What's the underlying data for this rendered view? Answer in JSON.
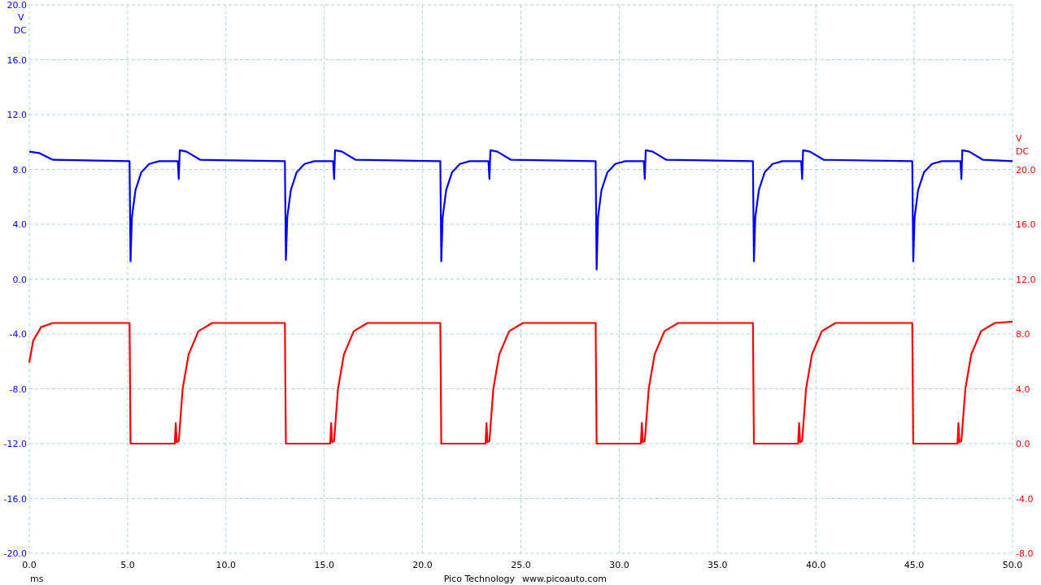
{
  "scope": {
    "chart_data": {
      "type": "line",
      "grid": true,
      "xlabel": "ms",
      "xlim": [
        0,
        50
      ],
      "xticks": [
        {
          "value": 0,
          "label": "0.0"
        },
        {
          "value": 5,
          "label": "5.0"
        },
        {
          "value": 10,
          "label": "10.0"
        },
        {
          "value": 15,
          "label": "15.0"
        },
        {
          "value": 20,
          "label": "20.0"
        },
        {
          "value": 25,
          "label": "25.0"
        },
        {
          "value": 30,
          "label": "30.0"
        },
        {
          "value": 35,
          "label": "35.0"
        },
        {
          "value": 40,
          "label": "40.0"
        },
        {
          "value": 45,
          "label": "45.0"
        },
        {
          "value": 50,
          "label": "50.0"
        }
      ],
      "ylim": [
        -20,
        20
      ],
      "yticks": [
        {
          "value": 20,
          "label": "20.0"
        },
        {
          "value": 16,
          "label": "16.0"
        },
        {
          "value": 12,
          "label": "12.0"
        },
        {
          "value": 8,
          "label": "8.0"
        },
        {
          "value": 4,
          "label": "4.0"
        },
        {
          "value": 0,
          "label": "0.0"
        },
        {
          "value": -4,
          "label": "-4.0"
        },
        {
          "value": -8,
          "label": "-8.0"
        },
        {
          "value": -12,
          "label": "-12.0"
        },
        {
          "value": -16,
          "label": "-16.0"
        },
        {
          "value": -20,
          "label": "-20.0"
        }
      ],
      "ylabel": "V DC",
      "y2lim": [
        -8,
        32
      ],
      "y2ticks": [
        {
          "value": 20,
          "label": "20.0"
        },
        {
          "value": 16,
          "label": "16.0"
        },
        {
          "value": 12,
          "label": "12.0"
        },
        {
          "value": 8,
          "label": "8.0"
        },
        {
          "value": 4,
          "label": "4.0"
        },
        {
          "value": 0,
          "label": "0.0"
        },
        {
          "value": -4,
          "label": "-4.0"
        },
        {
          "value": -8,
          "label": "-8.0"
        }
      ],
      "y2label": "V DC",
      "series": [
        {
          "color": "#0000ff",
          "x": [
            0,
            0.5,
            1.2,
            5.1,
            5.15,
            5.22,
            5.4,
            5.7,
            6.1,
            6.6,
            7.55,
            7.6,
            7.65,
            8.0,
            8.7,
            13.0,
            13.05,
            13.12,
            13.3,
            13.6,
            14.0,
            14.5,
            15.45,
            15.5,
            15.55,
            15.9,
            16.6,
            20.9,
            20.95,
            21.02,
            21.2,
            21.5,
            21.9,
            22.4,
            23.35,
            23.4,
            23.45,
            23.8,
            24.5,
            28.8,
            28.85,
            28.92,
            29.1,
            29.4,
            29.8,
            30.3,
            31.25,
            31.3,
            31.35,
            31.7,
            32.4,
            36.8,
            36.85,
            36.92,
            37.1,
            37.4,
            37.8,
            38.3,
            39.25,
            39.3,
            39.35,
            39.7,
            40.4,
            44.9,
            44.95,
            45.02,
            45.2,
            45.5,
            45.9,
            46.4,
            47.35,
            47.4,
            47.45,
            47.8,
            48.5,
            50
          ],
          "values": [
            9.3,
            9.2,
            8.7,
            8.6,
            1.3,
            4.5,
            6.5,
            7.8,
            8.4,
            8.6,
            8.6,
            7.3,
            9.4,
            9.3,
            8.7,
            8.6,
            1.4,
            4.5,
            6.5,
            7.8,
            8.4,
            8.6,
            8.6,
            7.3,
            9.4,
            9.3,
            8.7,
            8.6,
            1.3,
            4.5,
            6.5,
            7.8,
            8.4,
            8.6,
            8.6,
            7.3,
            9.4,
            9.3,
            8.7,
            8.6,
            0.7,
            4.5,
            6.5,
            7.8,
            8.4,
            8.6,
            8.6,
            7.3,
            9.4,
            9.3,
            8.7,
            8.6,
            1.3,
            4.5,
            6.5,
            7.8,
            8.4,
            8.6,
            8.6,
            7.3,
            9.4,
            9.3,
            8.7,
            8.6,
            1.3,
            4.5,
            6.5,
            7.8,
            8.4,
            8.6,
            8.6,
            7.3,
            9.4,
            9.3,
            8.7,
            8.6
          ]
        },
        {
          "color": "#ff0000",
          "axis": "y2",
          "x": [
            0,
            0.2,
            0.6,
            1.2,
            5.1,
            5.15,
            7.4,
            7.45,
            7.5,
            7.6,
            7.8,
            8.1,
            8.6,
            9.3,
            13.0,
            13.05,
            15.3,
            15.35,
            15.4,
            15.5,
            15.7,
            16.0,
            16.5,
            17.2,
            20.9,
            20.95,
            23.2,
            23.25,
            23.3,
            23.4,
            23.6,
            23.9,
            24.4,
            25.1,
            28.8,
            28.85,
            31.1,
            31.15,
            31.2,
            31.3,
            31.5,
            31.8,
            32.3,
            33.0,
            36.8,
            36.85,
            39.1,
            39.15,
            39.2,
            39.3,
            39.5,
            39.8,
            40.3,
            41.0,
            44.9,
            44.95,
            47.2,
            47.25,
            47.3,
            47.4,
            47.6,
            47.9,
            48.4,
            49.1,
            50
          ],
          "values": [
            5.9,
            7.5,
            8.5,
            8.8,
            8.8,
            0.0,
            0.0,
            1.5,
            0.1,
            0.2,
            4.0,
            6.5,
            8.2,
            8.8,
            8.8,
            0.0,
            0.0,
            1.5,
            0.1,
            0.2,
            4.0,
            6.5,
            8.2,
            8.8,
            8.8,
            0.0,
            0.0,
            1.5,
            0.1,
            0.2,
            4.0,
            6.5,
            8.2,
            8.8,
            8.8,
            0.0,
            0.0,
            1.5,
            0.1,
            0.2,
            4.0,
            6.5,
            8.2,
            8.8,
            8.8,
            0.0,
            0.0,
            1.5,
            0.1,
            0.2,
            4.0,
            6.5,
            8.2,
            8.8,
            8.8,
            0.0,
            0.0,
            1.5,
            0.1,
            0.2,
            4.0,
            6.5,
            8.2,
            8.8,
            8.9
          ]
        }
      ]
    }
  },
  "footer": [
    "Pico Technology",
    "www.picoauto.com"
  ]
}
